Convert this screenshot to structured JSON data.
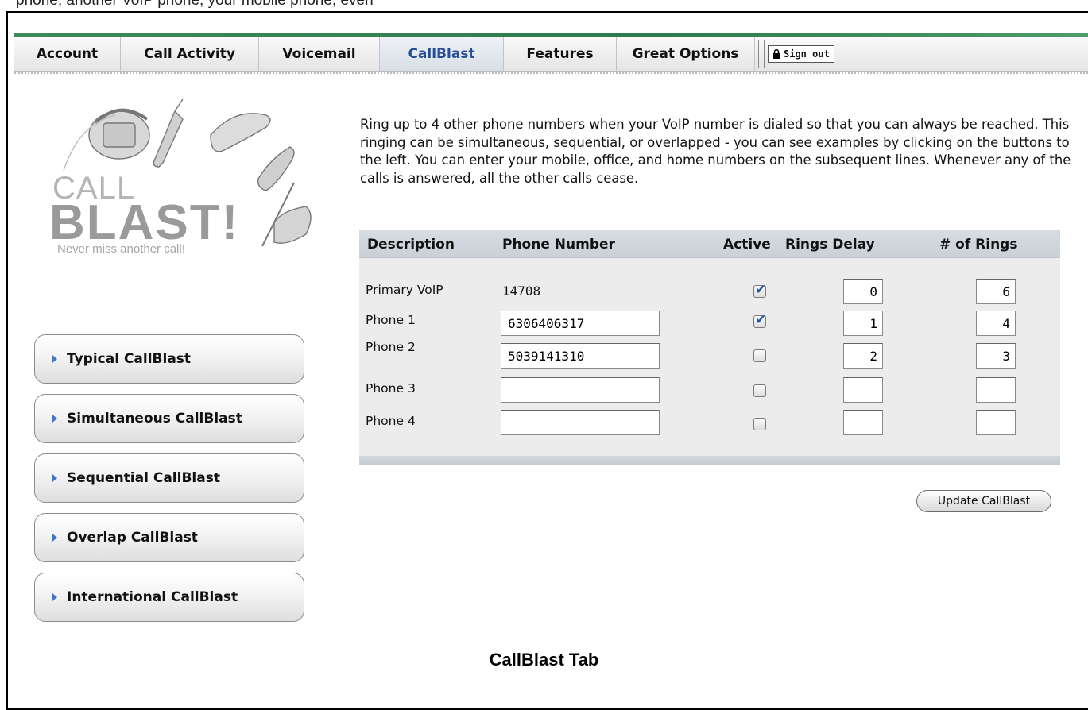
{
  "doc": {
    "top_text": "phone, another VoIP phone, your mobile phone, even",
    "caption": "CallBlast Tab"
  },
  "nav": {
    "tabs": [
      {
        "label": "Account"
      },
      {
        "label": "Call Activity"
      },
      {
        "label": "Voicemail"
      },
      {
        "label": "CallBlast",
        "active": true
      },
      {
        "label": "Features"
      },
      {
        "label": "Great Options"
      }
    ],
    "signout_label": "Sign out",
    "accent_color": "#274f95",
    "line_color": "#3c8a5a"
  },
  "logo": {
    "call": "CALL",
    "blast": "BLAST!",
    "tagline": "Never miss another call!"
  },
  "description": "Ring up to 4 other phone numbers when your VoIP number is dialed so that you can always be reached. This ringing can be simultaneous, sequential, or overlapped - you can see examples by clicking on the buttons to the left. You can enter your mobile, office, and home numbers on the subsequent lines. Whenever any of the calls is answered, all the other calls cease.",
  "table": {
    "headers": {
      "description": "Description",
      "phone": "Phone Number",
      "active": "Active",
      "delay": "Rings Delay",
      "rings": "# of Rings"
    },
    "rows": [
      {
        "label": "Primary VoIP",
        "phone": "14708",
        "editable": false,
        "active": true,
        "delay": "0",
        "rings": "6"
      },
      {
        "label": "Phone 1",
        "phone": "6306406317",
        "editable": true,
        "active": true,
        "delay": "1",
        "rings": "4"
      },
      {
        "label": "Phone 2",
        "phone": "5039141310",
        "editable": true,
        "active": false,
        "delay": "2",
        "rings": "3"
      },
      {
        "label": "Phone 3",
        "phone": "",
        "editable": true,
        "active": false,
        "delay": "",
        "rings": ""
      },
      {
        "label": "Phone 4",
        "phone": "",
        "editable": true,
        "active": false,
        "delay": "",
        "rings": ""
      }
    ],
    "update_label": "Update CallBlast"
  },
  "sidebar": {
    "buttons": [
      {
        "label": "Typical CallBlast"
      },
      {
        "label": "Simultaneous CallBlast"
      },
      {
        "label": "Sequential CallBlast"
      },
      {
        "label": "Overlap CallBlast"
      },
      {
        "label": "International CallBlast"
      }
    ]
  }
}
